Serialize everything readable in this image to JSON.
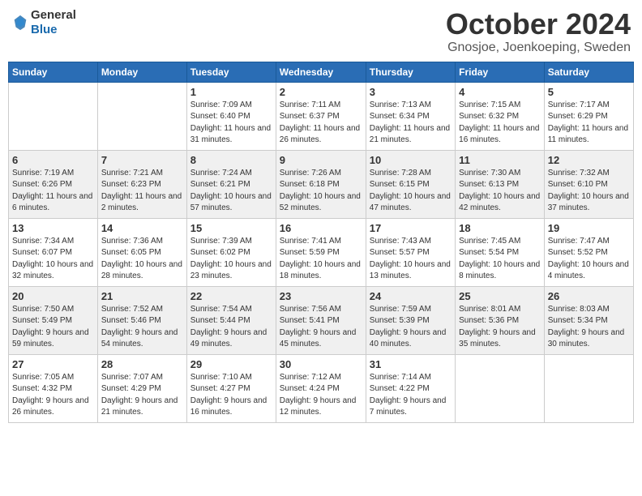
{
  "header": {
    "logo_general": "General",
    "logo_blue": "Blue",
    "month": "October 2024",
    "location": "Gnosjoe, Joenkoeping, Sweden"
  },
  "weekdays": [
    "Sunday",
    "Monday",
    "Tuesday",
    "Wednesday",
    "Thursday",
    "Friday",
    "Saturday"
  ],
  "weeks": [
    [
      {
        "day": "",
        "info": ""
      },
      {
        "day": "",
        "info": ""
      },
      {
        "day": "1",
        "info": "Sunrise: 7:09 AM\nSunset: 6:40 PM\nDaylight: 11 hours and 31 minutes."
      },
      {
        "day": "2",
        "info": "Sunrise: 7:11 AM\nSunset: 6:37 PM\nDaylight: 11 hours and 26 minutes."
      },
      {
        "day": "3",
        "info": "Sunrise: 7:13 AM\nSunset: 6:34 PM\nDaylight: 11 hours and 21 minutes."
      },
      {
        "day": "4",
        "info": "Sunrise: 7:15 AM\nSunset: 6:32 PM\nDaylight: 11 hours and 16 minutes."
      },
      {
        "day": "5",
        "info": "Sunrise: 7:17 AM\nSunset: 6:29 PM\nDaylight: 11 hours and 11 minutes."
      }
    ],
    [
      {
        "day": "6",
        "info": "Sunrise: 7:19 AM\nSunset: 6:26 PM\nDaylight: 11 hours and 6 minutes."
      },
      {
        "day": "7",
        "info": "Sunrise: 7:21 AM\nSunset: 6:23 PM\nDaylight: 11 hours and 2 minutes."
      },
      {
        "day": "8",
        "info": "Sunrise: 7:24 AM\nSunset: 6:21 PM\nDaylight: 10 hours and 57 minutes."
      },
      {
        "day": "9",
        "info": "Sunrise: 7:26 AM\nSunset: 6:18 PM\nDaylight: 10 hours and 52 minutes."
      },
      {
        "day": "10",
        "info": "Sunrise: 7:28 AM\nSunset: 6:15 PM\nDaylight: 10 hours and 47 minutes."
      },
      {
        "day": "11",
        "info": "Sunrise: 7:30 AM\nSunset: 6:13 PM\nDaylight: 10 hours and 42 minutes."
      },
      {
        "day": "12",
        "info": "Sunrise: 7:32 AM\nSunset: 6:10 PM\nDaylight: 10 hours and 37 minutes."
      }
    ],
    [
      {
        "day": "13",
        "info": "Sunrise: 7:34 AM\nSunset: 6:07 PM\nDaylight: 10 hours and 32 minutes."
      },
      {
        "day": "14",
        "info": "Sunrise: 7:36 AM\nSunset: 6:05 PM\nDaylight: 10 hours and 28 minutes."
      },
      {
        "day": "15",
        "info": "Sunrise: 7:39 AM\nSunset: 6:02 PM\nDaylight: 10 hours and 23 minutes."
      },
      {
        "day": "16",
        "info": "Sunrise: 7:41 AM\nSunset: 5:59 PM\nDaylight: 10 hours and 18 minutes."
      },
      {
        "day": "17",
        "info": "Sunrise: 7:43 AM\nSunset: 5:57 PM\nDaylight: 10 hours and 13 minutes."
      },
      {
        "day": "18",
        "info": "Sunrise: 7:45 AM\nSunset: 5:54 PM\nDaylight: 10 hours and 8 minutes."
      },
      {
        "day": "19",
        "info": "Sunrise: 7:47 AM\nSunset: 5:52 PM\nDaylight: 10 hours and 4 minutes."
      }
    ],
    [
      {
        "day": "20",
        "info": "Sunrise: 7:50 AM\nSunset: 5:49 PM\nDaylight: 9 hours and 59 minutes."
      },
      {
        "day": "21",
        "info": "Sunrise: 7:52 AM\nSunset: 5:46 PM\nDaylight: 9 hours and 54 minutes."
      },
      {
        "day": "22",
        "info": "Sunrise: 7:54 AM\nSunset: 5:44 PM\nDaylight: 9 hours and 49 minutes."
      },
      {
        "day": "23",
        "info": "Sunrise: 7:56 AM\nSunset: 5:41 PM\nDaylight: 9 hours and 45 minutes."
      },
      {
        "day": "24",
        "info": "Sunrise: 7:59 AM\nSunset: 5:39 PM\nDaylight: 9 hours and 40 minutes."
      },
      {
        "day": "25",
        "info": "Sunrise: 8:01 AM\nSunset: 5:36 PM\nDaylight: 9 hours and 35 minutes."
      },
      {
        "day": "26",
        "info": "Sunrise: 8:03 AM\nSunset: 5:34 PM\nDaylight: 9 hours and 30 minutes."
      }
    ],
    [
      {
        "day": "27",
        "info": "Sunrise: 7:05 AM\nSunset: 4:32 PM\nDaylight: 9 hours and 26 minutes."
      },
      {
        "day": "28",
        "info": "Sunrise: 7:07 AM\nSunset: 4:29 PM\nDaylight: 9 hours and 21 minutes."
      },
      {
        "day": "29",
        "info": "Sunrise: 7:10 AM\nSunset: 4:27 PM\nDaylight: 9 hours and 16 minutes."
      },
      {
        "day": "30",
        "info": "Sunrise: 7:12 AM\nSunset: 4:24 PM\nDaylight: 9 hours and 12 minutes."
      },
      {
        "day": "31",
        "info": "Sunrise: 7:14 AM\nSunset: 4:22 PM\nDaylight: 9 hours and 7 minutes."
      },
      {
        "day": "",
        "info": ""
      },
      {
        "day": "",
        "info": ""
      }
    ]
  ]
}
